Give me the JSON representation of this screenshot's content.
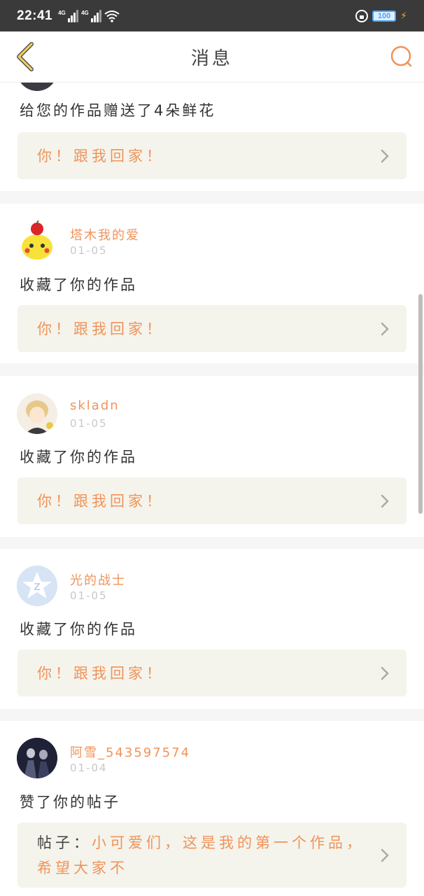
{
  "status_bar": {
    "time": "22:41",
    "network_1": "4G",
    "network_2": "4G",
    "battery": "100",
    "icons": [
      "signal-icon",
      "wifi-icon",
      "rotation-lock-icon",
      "battery-icon",
      "charging-icon"
    ]
  },
  "header": {
    "title": "消息",
    "back_icon": "chevron-left-icon",
    "search_icon": "search-icon",
    "accent_color": "#f0935a",
    "back_color": "#e8c84a"
  },
  "first_card": {
    "action": "给您的作品赠送了4朵鲜花",
    "link_text": "你！跟我回家！"
  },
  "messages": [
    {
      "username": "塔木我的爱",
      "date": "01-05",
      "action": "收藏了你的作品",
      "link_text": "你！跟我回家！"
    },
    {
      "username": "skladn",
      "date": "01-05",
      "action": "收藏了你的作品",
      "link_text": "你！跟我回家！"
    },
    {
      "username": "光的战士",
      "date": "01-05",
      "action": "收藏了你的作品",
      "link_text": "你！跟我回家！"
    },
    {
      "username": "阿雪_543597574",
      "date": "01-04",
      "action": "赞了你的帖子",
      "link_prefix": "帖子：",
      "link_text": "小可爱们，这是我的第一个作品，希望大家不"
    }
  ]
}
